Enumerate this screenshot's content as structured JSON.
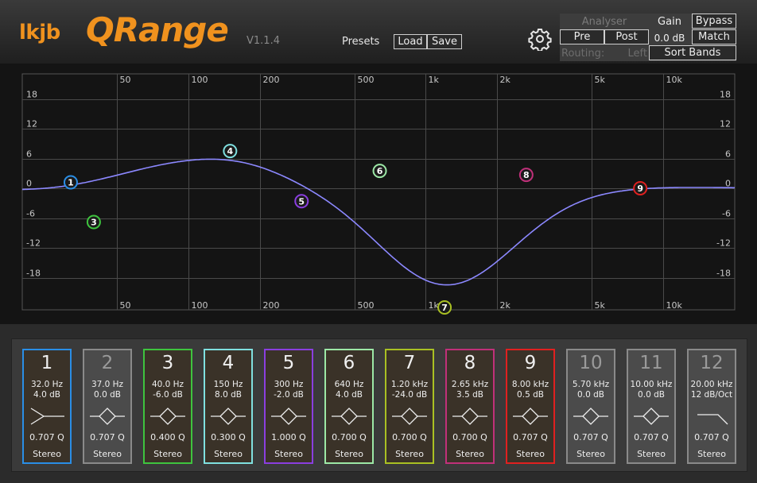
{
  "header": {
    "brand_prefix": "lkjb",
    "brand_name": "QRange",
    "version": "V1.1.4",
    "presets_label": "Presets",
    "load_label": "Load",
    "save_label": "Save",
    "settings_icon": "gear-icon"
  },
  "controls": {
    "analyser_label": "Analyser",
    "pre_label": "Pre",
    "post_label": "Post",
    "gain_label": "Gain",
    "gain_value": "0.0 dB",
    "bypass_label": "Bypass",
    "match_label": "Match",
    "routing_label": "Routing:",
    "routing_value": "Left",
    "sort_bands_label": "Sort Bands"
  },
  "graph": {
    "freq_ticks": [
      "50",
      "100",
      "200",
      "500",
      "1k",
      "2k",
      "5k",
      "10k"
    ],
    "db_ticks": [
      "18",
      "12",
      "6",
      "0",
      "-6",
      "-12",
      "-18"
    ],
    "curve_color": "#8c88ff",
    "nodes": [
      {
        "label": "1",
        "color": "#2a8ee6",
        "hz": 32,
        "db": 1.2
      },
      {
        "label": "3",
        "color": "#3ec43e",
        "hz": 40,
        "db": -6.8
      },
      {
        "label": "4",
        "color": "#7fe0e0",
        "hz": 150,
        "db": 7.5
      },
      {
        "label": "5",
        "color": "#8a3ee0",
        "hz": 300,
        "db": -2.6
      },
      {
        "label": "6",
        "color": "#9ce8a6",
        "hz": 640,
        "db": 3.5
      },
      {
        "label": "7",
        "color": "#a9c023",
        "hz": 1200,
        "db": -24
      },
      {
        "label": "8",
        "color": "#c0307a",
        "hz": 2650,
        "db": 2.7
      },
      {
        "label": "9",
        "color": "#e02020",
        "hz": 8000,
        "db": 0
      }
    ]
  },
  "bands": [
    {
      "num": "1",
      "freq": "32.0 Hz",
      "gain": "4.0 dB",
      "q": "0.707 Q",
      "mode": "Stereo",
      "color": "#2a8ee6",
      "on": true,
      "shape": "lowcut-icon"
    },
    {
      "num": "2",
      "freq": "37.0 Hz",
      "gain": "0.0 dB",
      "q": "0.707 Q",
      "mode": "Stereo",
      "color": "#8a8a8a",
      "on": false,
      "shape": "bell-icon"
    },
    {
      "num": "3",
      "freq": "40.0 Hz",
      "gain": "-6.0 dB",
      "q": "0.400 Q",
      "mode": "Stereo",
      "color": "#3ec43e",
      "on": true,
      "shape": "bell-icon"
    },
    {
      "num": "4",
      "freq": "150 Hz",
      "gain": "8.0 dB",
      "q": "0.300 Q",
      "mode": "Stereo",
      "color": "#7fe0e0",
      "on": true,
      "shape": "bell-icon"
    },
    {
      "num": "5",
      "freq": "300 Hz",
      "gain": "-2.0 dB",
      "q": "1.000 Q",
      "mode": "Stereo",
      "color": "#8a3ee0",
      "on": true,
      "shape": "bell-icon"
    },
    {
      "num": "6",
      "freq": "640 Hz",
      "gain": "4.0 dB",
      "q": "0.700 Q",
      "mode": "Stereo",
      "color": "#9ce8a6",
      "on": true,
      "shape": "bell-icon"
    },
    {
      "num": "7",
      "freq": "1.20 kHz",
      "gain": "-24.0 dB",
      "q": "0.700 Q",
      "mode": "Stereo",
      "color": "#a9c023",
      "on": true,
      "shape": "bell-icon"
    },
    {
      "num": "8",
      "freq": "2.65 kHz",
      "gain": "3.5 dB",
      "q": "0.700 Q",
      "mode": "Stereo",
      "color": "#c0307a",
      "on": true,
      "shape": "bell-icon"
    },
    {
      "num": "9",
      "freq": "8.00 kHz",
      "gain": "0.5 dB",
      "q": "0.707 Q",
      "mode": "Stereo",
      "color": "#e02020",
      "on": true,
      "shape": "bell-icon"
    },
    {
      "num": "10",
      "freq": "5.70 kHz",
      "gain": "0.0 dB",
      "q": "0.707 Q",
      "mode": "Stereo",
      "color": "#8a8a8a",
      "on": false,
      "shape": "bell-icon"
    },
    {
      "num": "11",
      "freq": "10.00 kHz",
      "gain": "0.0 dB",
      "q": "0.707 Q",
      "mode": "Stereo",
      "color": "#8a8a8a",
      "on": false,
      "shape": "bell-icon"
    },
    {
      "num": "12",
      "freq": "20.00 kHz",
      "gain": "12 dB/Oct",
      "q": "0.707 Q",
      "mode": "Stereo",
      "color": "#8a8a8a",
      "on": false,
      "shape": "highcut-icon"
    }
  ]
}
